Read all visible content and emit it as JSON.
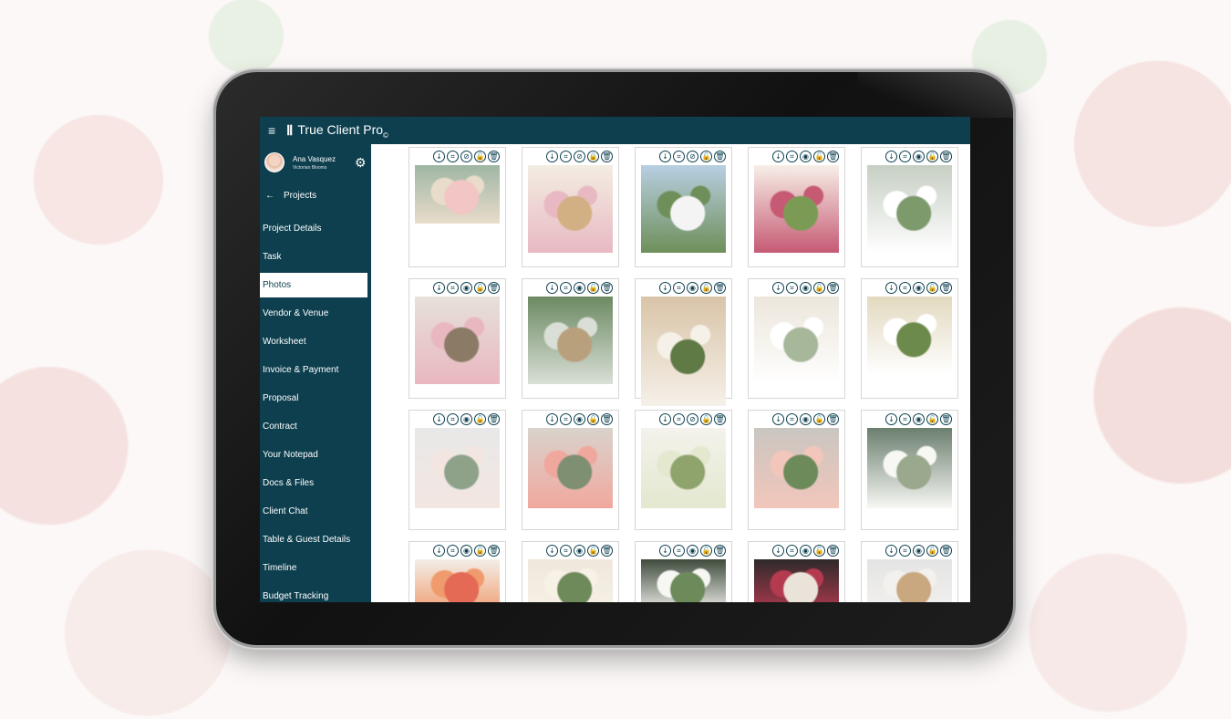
{
  "app": {
    "title_prefix": "True Client Pro",
    "title_mark": "©",
    "logo_glyph": "Ⅱ",
    "menu_glyph": "≡"
  },
  "user": {
    "name": "Ana Vasquez",
    "company": "Victorian Blooms"
  },
  "nav": {
    "back_label": "Projects",
    "items": [
      {
        "label": "Project Details"
      },
      {
        "label": "Task"
      },
      {
        "label": "Photos",
        "active": true
      },
      {
        "label": "Vendor & Venue"
      },
      {
        "label": "Worksheet"
      },
      {
        "label": "Invoice & Payment"
      },
      {
        "label": "Proposal"
      },
      {
        "label": "Contract"
      },
      {
        "label": "Your Notepad"
      },
      {
        "label": "Docs & Files"
      },
      {
        "label": "Client Chat"
      },
      {
        "label": "Table & Guest Details"
      },
      {
        "label": "Timeline"
      },
      {
        "label": "Budget Tracking"
      }
    ]
  },
  "icons": {
    "download": "↓",
    "crop": "⌗",
    "view": "◉",
    "hidden": "⊘",
    "unlock": "🔓",
    "lock": "🔒",
    "delete": "🗑",
    "gear": "⚙",
    "back": "←"
  },
  "colors": {
    "primary": "#0d3f4f",
    "border": "#d6d6d6",
    "active_bg": "#ffffff"
  },
  "photos": [
    {
      "visibility": "hidden",
      "lock": "unlock"
    },
    {
      "visibility": "hidden",
      "lock": "lock"
    },
    {
      "visibility": "hidden",
      "lock": "unlock"
    },
    {
      "visibility": "view",
      "lock": "unlock"
    },
    {
      "visibility": "view",
      "lock": "unlock"
    },
    {
      "visibility": "view",
      "lock": "unlock"
    },
    {
      "visibility": "view",
      "lock": "unlock"
    },
    {
      "visibility": "view",
      "lock": "unlock"
    },
    {
      "visibility": "view",
      "lock": "unlock"
    },
    {
      "visibility": "view",
      "lock": "unlock"
    },
    {
      "visibility": "view",
      "lock": "unlock"
    },
    {
      "visibility": "view",
      "lock": "unlock"
    },
    {
      "visibility": "hidden",
      "lock": "unlock"
    },
    {
      "visibility": "view",
      "lock": "unlock"
    },
    {
      "visibility": "view",
      "lock": "unlock"
    },
    {
      "visibility": "view",
      "lock": "unlock"
    },
    {
      "visibility": "view",
      "lock": "unlock"
    },
    {
      "visibility": "view",
      "lock": "unlock"
    },
    {
      "visibility": "view",
      "lock": "unlock"
    },
    {
      "visibility": "view",
      "lock": "unlock"
    }
  ]
}
